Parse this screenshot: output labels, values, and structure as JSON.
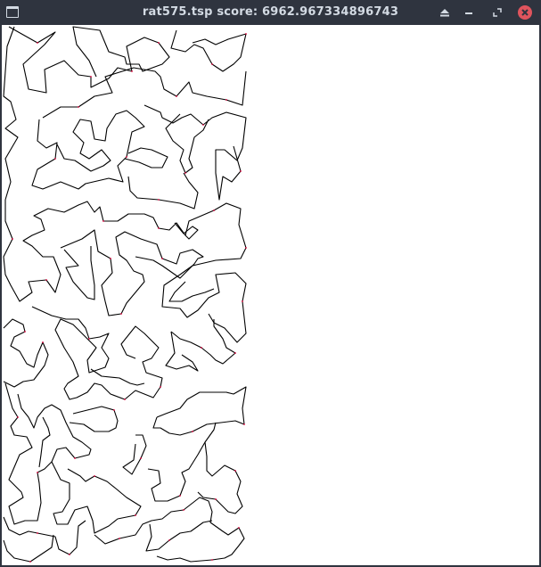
{
  "window": {
    "title": "rat575.tsp score: 6962.967334896743",
    "icons": {
      "app": "window-icon",
      "eject": "eject-icon",
      "minimize": "minimize-icon",
      "restore": "restore-icon",
      "close": "close-icon"
    },
    "colors": {
      "titlebar_bg": "#2f343f",
      "title_text": "#d3dae3",
      "close_button": "#e0545d",
      "canvas_bg": "#ffffff",
      "tour_line": "#000000",
      "city_point": "#e0003c"
    }
  },
  "tour": {
    "instance": "rat575",
    "score": 6962.967334896743
  }
}
